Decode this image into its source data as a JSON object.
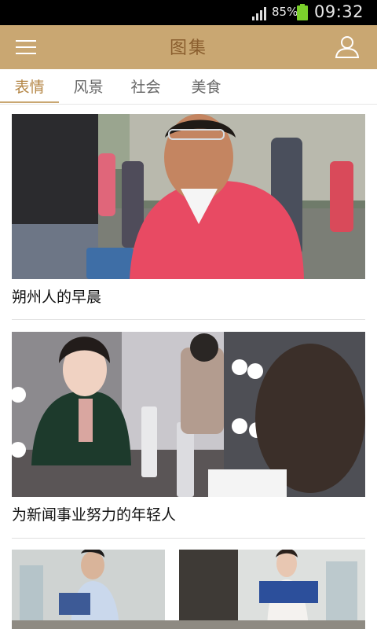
{
  "status_bar": {
    "battery_percent": "85%",
    "time": "09:32"
  },
  "header": {
    "title": "图集",
    "menu_icon": "menu-icon",
    "user_icon": "user-icon",
    "background_color": "#c9a772"
  },
  "tabs": [
    {
      "label": "表情",
      "active": true
    },
    {
      "label": "风景",
      "active": false
    },
    {
      "label": "社会",
      "active": false
    },
    {
      "label": "美食",
      "active": false
    }
  ],
  "feed": [
    {
      "caption": "朔州人的早晨"
    },
    {
      "caption": "为新闻事业努力的年轻人"
    },
    {
      "caption": ""
    }
  ]
}
